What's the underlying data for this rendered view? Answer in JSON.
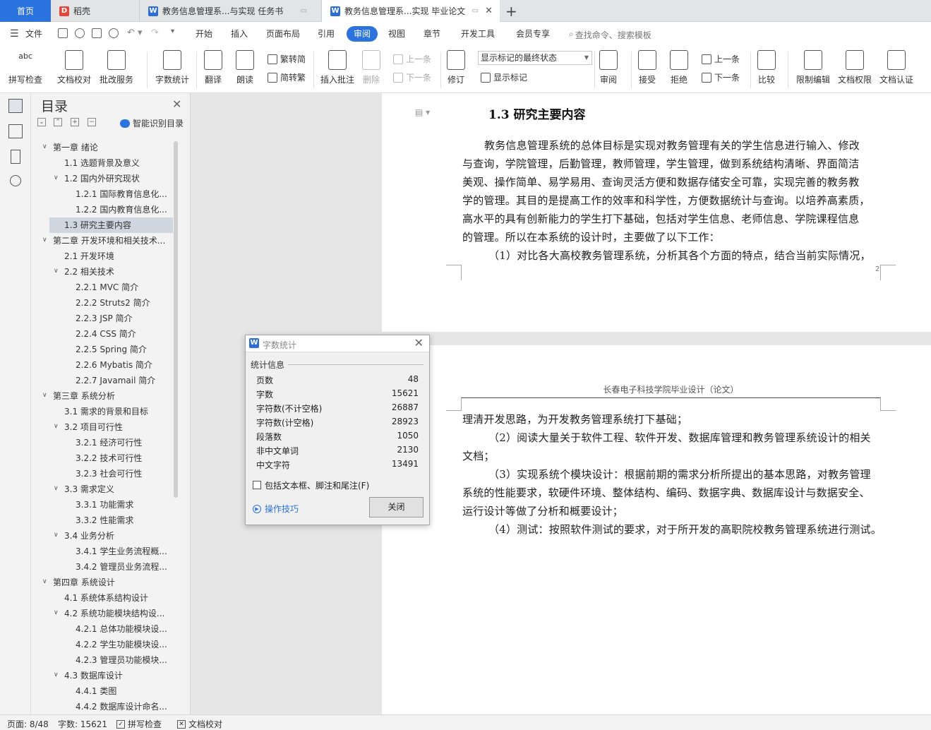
{
  "tabs": {
    "home": "首页",
    "t1": "稻壳",
    "t2": "教务信息管理系...与实现 任务书",
    "t3": "教务信息管理系...实现 毕业论文"
  },
  "menu": {
    "file": "文件",
    "items": [
      "开始",
      "插入",
      "页面布局",
      "引用",
      "审阅",
      "视图",
      "章节",
      "开发工具",
      "会员专享"
    ],
    "active": "审阅",
    "search": "查找命令、搜索模板"
  },
  "ribbon": {
    "spell": "拼写检查",
    "proofread": "文档校对",
    "batch": "批改服务",
    "wordcount": "字数统计",
    "translate": "翻译",
    "read": "朗读",
    "trad": "繁转简",
    "simp": "简转繁",
    "insert_comment": "插入批注",
    "delete": "删除",
    "prev1": "上一条",
    "next1": "下一条",
    "revise": "修订",
    "mark_state": "显示标记的最终状态",
    "show_marks": "显示标记",
    "review": "审阅",
    "accept": "接受",
    "reject": "拒绝",
    "prev2": "上一条",
    "next2": "下一条",
    "compare": "比较",
    "restrict": "限制编辑",
    "doc_perm": "文档权限",
    "doc_cert": "文档认证"
  },
  "toc": {
    "title": "目录",
    "smart": "智能识别目录",
    "items": [
      {
        "text": "第一章  绪论",
        "level": 0,
        "arrow": true
      },
      {
        "text": "1.1  选题背景及意义",
        "level": 1,
        "arrow": false
      },
      {
        "text": "1.2 国内外研究现状",
        "level": 1,
        "arrow": true
      },
      {
        "text": "1.2.1 国际教育信息化...",
        "level": 2,
        "arrow": false
      },
      {
        "text": "1.2.2 国内教育信息化...",
        "level": 2,
        "arrow": false
      },
      {
        "text": "1.3 研究主要内容",
        "level": 1,
        "arrow": false,
        "selected": true
      },
      {
        "text": "第二章  开发环境和相关技术...",
        "level": 0,
        "arrow": true
      },
      {
        "text": "2.1  开发环境",
        "level": 1,
        "arrow": false
      },
      {
        "text": "2.2  相关技术",
        "level": 1,
        "arrow": true
      },
      {
        "text": "2.2.1 MVC 简介",
        "level": 2,
        "arrow": false
      },
      {
        "text": "2.2.2 Struts2 简介",
        "level": 2,
        "arrow": false
      },
      {
        "text": "2.2.3 JSP 简介",
        "level": 2,
        "arrow": false
      },
      {
        "text": "2.2.4 CSS 简介",
        "level": 2,
        "arrow": false
      },
      {
        "text": "2.2.5 Spring 简介",
        "level": 2,
        "arrow": false
      },
      {
        "text": "2.2.6 Mybatis 简介",
        "level": 2,
        "arrow": false
      },
      {
        "text": "2.2.7 Javamail 简介",
        "level": 2,
        "arrow": false
      },
      {
        "text": "第三章  系统分析",
        "level": 0,
        "arrow": true
      },
      {
        "text": "3.1  需求的背景和目标",
        "level": 1,
        "arrow": false
      },
      {
        "text": "3.2  项目可行性",
        "level": 1,
        "arrow": true
      },
      {
        "text": "3.2.1  经济可行性",
        "level": 2,
        "arrow": false
      },
      {
        "text": "3.2.2  技术可行性",
        "level": 2,
        "arrow": false
      },
      {
        "text": "3.2.3  社会可行性",
        "level": 2,
        "arrow": false
      },
      {
        "text": "3.3  需求定义",
        "level": 1,
        "arrow": true
      },
      {
        "text": "3.3.1  功能需求",
        "level": 2,
        "arrow": false
      },
      {
        "text": "3.3.2  性能需求",
        "level": 2,
        "arrow": false
      },
      {
        "text": "3.4  业务分析",
        "level": 1,
        "arrow": true
      },
      {
        "text": "3.4.1  学生业务流程概...",
        "level": 2,
        "arrow": false
      },
      {
        "text": "3.4.2  管理员业务流程...",
        "level": 2,
        "arrow": false
      },
      {
        "text": "第四章  系统设计",
        "level": 0,
        "arrow": true
      },
      {
        "text": "4.1  系统体系结构设计",
        "level": 1,
        "arrow": false
      },
      {
        "text": "4.2  系统功能模块结构设...",
        "level": 1,
        "arrow": true
      },
      {
        "text": "4.2.1  总体功能模块设...",
        "level": 2,
        "arrow": false
      },
      {
        "text": "4.2.2  学生功能模块设...",
        "level": 2,
        "arrow": false
      },
      {
        "text": "4.2.3  管理员功能模块...",
        "level": 2,
        "arrow": false
      },
      {
        "text": "4.3  数据库设计",
        "level": 1,
        "arrow": true
      },
      {
        "text": "4.4.1  类图",
        "level": 2,
        "arrow": false
      },
      {
        "text": "4.4.2  数据库设计命名...",
        "level": 2,
        "arrow": false
      }
    ]
  },
  "document": {
    "heading": "1.3 研究主要内容",
    "page1_lines": [
      "教务信息管理系统的总体目标是实现对教务管理有关的学生信息进行输入、修改",
      "与查询，学院管理，后勤管理，教师管理，学生管理，做到系统结构清晰、界面简洁",
      "美观、操作简单、易学易用、查询灵活方便和数据存储安全可靠，实现完善的教务教",
      "学的管理。其目的是提高工作的效率和科学性，方便数据统计与查询。以培养高素质，",
      "高水平的具有创新能力的学生打下基础，包括对学生信息、老师信息、学院课程信息",
      "的管理。所以在本系统的设计时，主要做了以下工作：",
      "（1）对比各大高校教务管理系统，分析其各个方面的特点，结合当前实际情况，"
    ],
    "page_number": "2",
    "header": "长春电子科技学院毕业设计（论文）",
    "page2_lines": [
      "理清开发思路，为开发教务管理系统打下基础；",
      "（2）阅读大量关于软件工程、软件开发、数据库管理和教务管理系统设计的相关",
      "文档；",
      "（3）实现系统个模块设计：根据前期的需求分析所提出的基本思路，对教务管理",
      "系统的性能要求，软硬件环境、整体结构、编码、数据字典、数据库设计与数据安全、",
      "运行设计等做了分析和概要设计；",
      "（4）测试：按照软件测试的要求，对于所开发的高职院校教务管理系统进行测试。"
    ]
  },
  "dialog": {
    "title": "字数统计",
    "section": "统计信息",
    "rows": [
      {
        "label": "页数",
        "value": "48"
      },
      {
        "label": "字数",
        "value": "15621"
      },
      {
        "label": "字符数(不计空格)",
        "value": "26887"
      },
      {
        "label": "字符数(计空格)",
        "value": "28923"
      },
      {
        "label": "段落数",
        "value": "1050"
      },
      {
        "label": "非中文单词",
        "value": "2130"
      },
      {
        "label": "中文字符",
        "value": "13491"
      }
    ],
    "checkbox": "包括文本框、脚注和尾注(F)",
    "tips": "操作技巧",
    "close": "关闭"
  },
  "status": {
    "page": "页面: 8/48",
    "words": "字数: 15621",
    "spell": "拼写检查",
    "proof": "文档校对"
  },
  "colors": {
    "accent": "#2b73df",
    "selected_toc": "#cfd6df"
  }
}
